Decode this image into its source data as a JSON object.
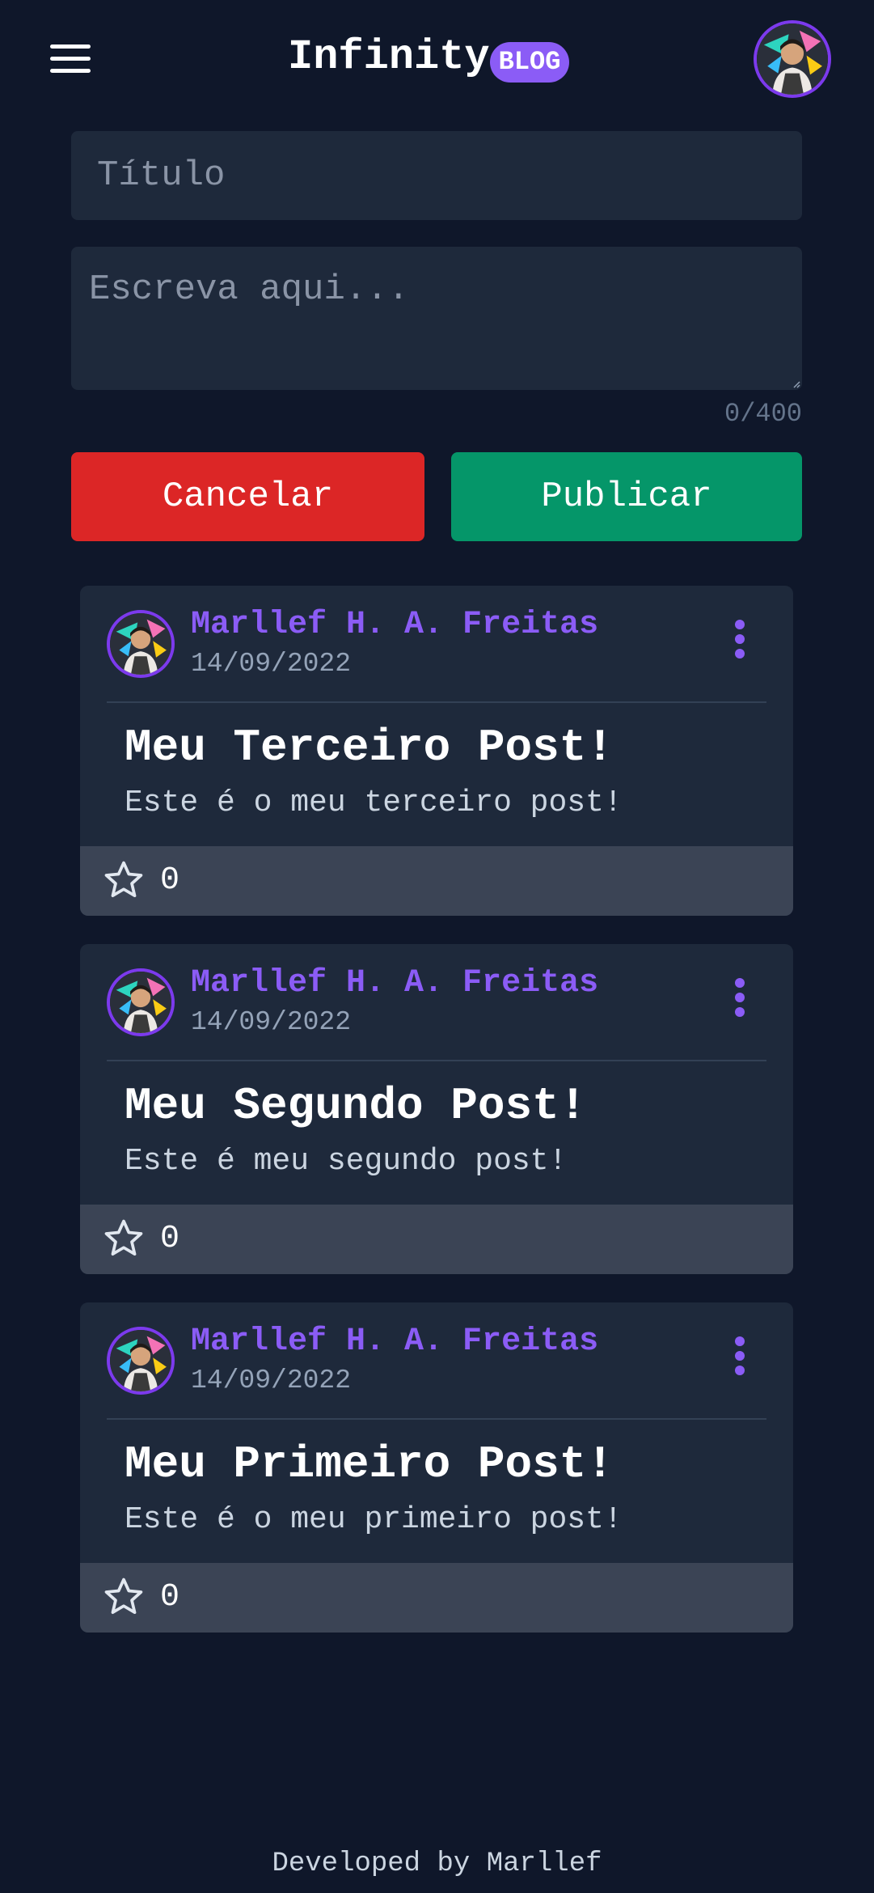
{
  "header": {
    "brand_name": "Infinity",
    "brand_badge": "BLOG"
  },
  "form": {
    "title_placeholder": "Título",
    "title_value": "",
    "body_placeholder": "Escreva aqui...",
    "body_value": "",
    "char_count": "0/400",
    "cancel_label": "Cancelar",
    "publish_label": "Publicar"
  },
  "posts": [
    {
      "author": "Marllef H. A. Freitas",
      "date": "14/09/2022",
      "title": "Meu Terceiro Post!",
      "body": "Este é o meu terceiro post!",
      "stars": "0"
    },
    {
      "author": "Marllef H. A. Freitas",
      "date": "14/09/2022",
      "title": "Meu Segundo Post!",
      "body": "Este é meu segundo post!",
      "stars": "0"
    },
    {
      "author": "Marllef H. A. Freitas",
      "date": "14/09/2022",
      "title": "Meu Primeiro Post!",
      "body": "Este é o meu primeiro post!",
      "stars": "0"
    }
  ],
  "footer": {
    "text": "Developed by Marllef"
  },
  "icons": {
    "menu": "hamburger-menu-icon",
    "options": "vertical-dots-icon",
    "star": "star-outline-icon"
  },
  "colors": {
    "background": "#0f172a",
    "card": "#1e293b",
    "accent": "#8b5cf6",
    "cancel": "#dc2626",
    "publish": "#059669"
  }
}
